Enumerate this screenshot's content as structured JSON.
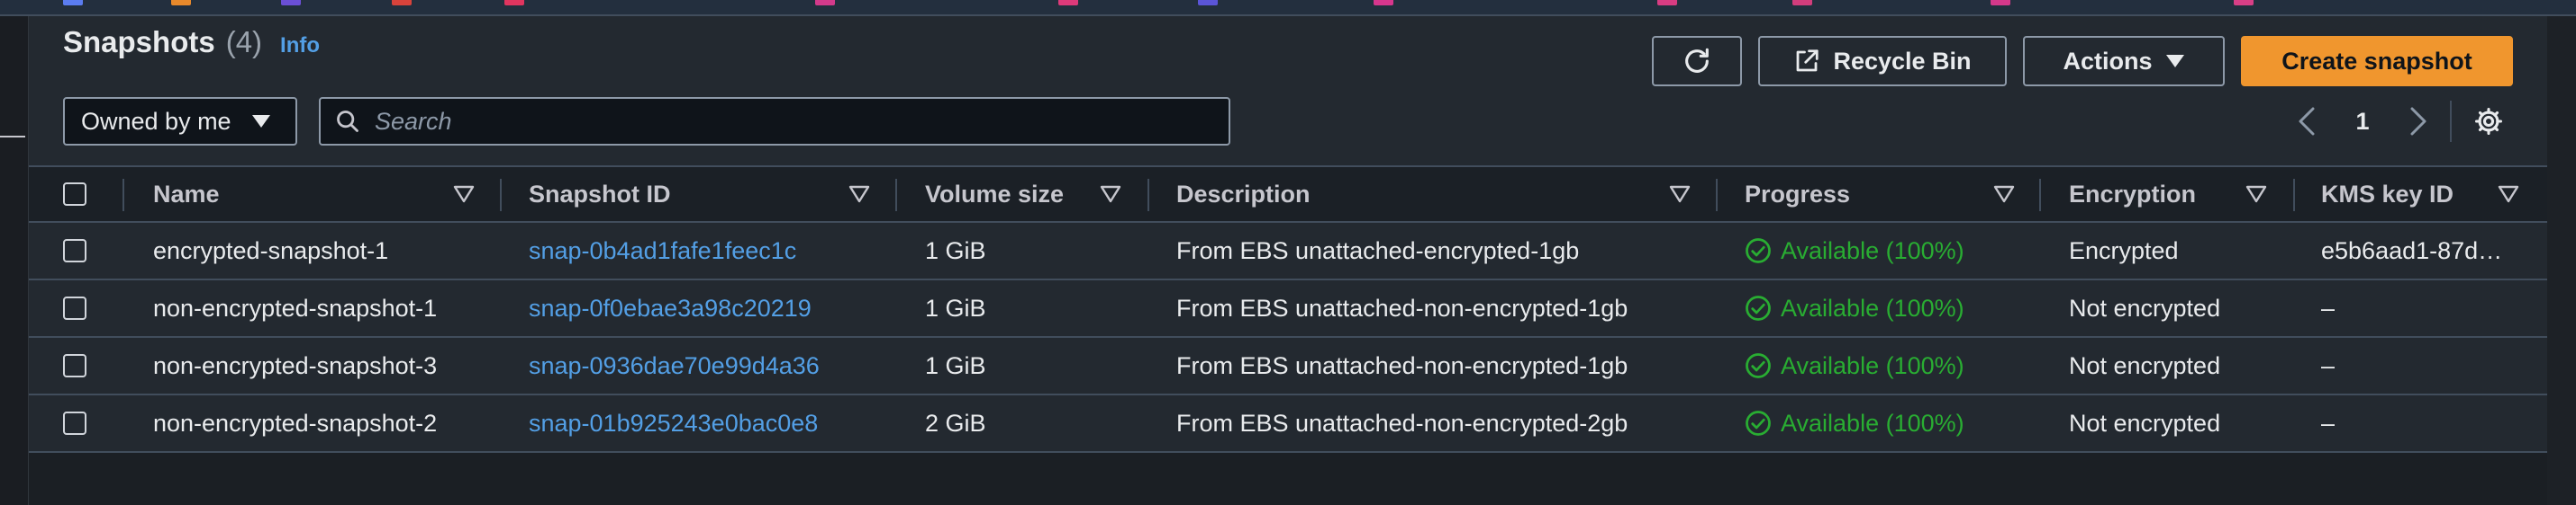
{
  "header": {
    "title": "Snapshots",
    "count": "(4)",
    "info_link": "Info"
  },
  "toolbar": {
    "refresh_icon": "refresh-icon",
    "recycle_bin_label": "Recycle Bin",
    "actions_label": "Actions",
    "create_label": "Create snapshot"
  },
  "filter": {
    "owner_selected": "Owned by me",
    "search_placeholder": "Search"
  },
  "pagination": {
    "current_page": "1"
  },
  "table": {
    "columns": [
      "Name",
      "Snapshot ID",
      "Volume size",
      "Description",
      "Progress",
      "Encryption",
      "KMS key ID"
    ],
    "rows": [
      {
        "name": "encrypted-snapshot-1",
        "snapshot_id": "snap-0b4ad1fafe1feec1c",
        "volume_size": "1 GiB",
        "description": "From EBS unattached-encrypted-1gb",
        "progress": "Available (100%)",
        "encryption": "Encrypted",
        "kms_key_id": "e5b6aad1-87d…"
      },
      {
        "name": "non-encrypted-snapshot-1",
        "snapshot_id": "snap-0f0ebae3a98c20219",
        "volume_size": "1 GiB",
        "description": "From EBS unattached-non-encrypted-1gb",
        "progress": "Available (100%)",
        "encryption": "Not encrypted",
        "kms_key_id": "–"
      },
      {
        "name": "non-encrypted-snapshot-3",
        "snapshot_id": "snap-0936dae70e99d4a36",
        "volume_size": "1 GiB",
        "description": "From EBS unattached-non-encrypted-1gb",
        "progress": "Available (100%)",
        "encryption": "Not encrypted",
        "kms_key_id": "–"
      },
      {
        "name": "non-encrypted-snapshot-2",
        "snapshot_id": "snap-01b925243e0bac0e8",
        "volume_size": "2 GiB",
        "description": "From EBS unattached-non-encrypted-2gb",
        "progress": "Available (100%)",
        "encryption": "Not encrypted",
        "kms_key_id": "–"
      }
    ]
  },
  "colors": {
    "accent": "#f0962e",
    "link": "#539fe5",
    "success": "#29ad32",
    "panel": "#232930"
  }
}
